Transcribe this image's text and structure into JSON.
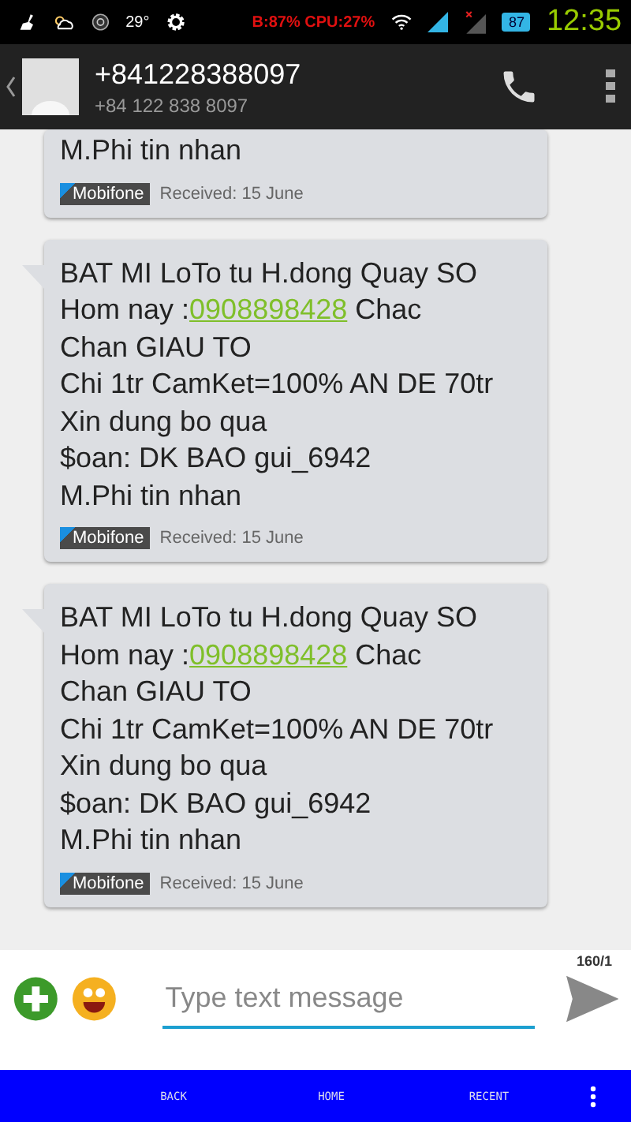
{
  "status_bar": {
    "temperature": "29°",
    "stats": "B:87% CPU:27%",
    "battery": "87",
    "time": "12:35"
  },
  "header": {
    "title": "+841228388097",
    "subtitle": "+84 122 838 8097"
  },
  "messages": [
    {
      "tail": false,
      "body": [
        {
          "kind": "text",
          "text": "M.Phi tin nhan"
        }
      ],
      "carrier": "Mobifone",
      "received": "Received: 15 June"
    },
    {
      "tail": true,
      "body": [
        {
          "kind": "text",
          "text": "BAT MI LoTo tu H.dong Quay SO\nHom nay :"
        },
        {
          "kind": "link",
          "text": "0908898428"
        },
        {
          "kind": "text",
          "text": " Chac\nChan GIAU TO\nChi 1tr CamKet=100% AN DE 70tr\nXin dung bo qua\n$oan: DK BAO gui_6942\nM.Phi tin nhan"
        }
      ],
      "carrier": "Mobifone",
      "received": "Received: 15 June"
    },
    {
      "tail": true,
      "body": [
        {
          "kind": "text",
          "text": "BAT MI LoTo tu H.dong Quay SO\nHom nay :"
        },
        {
          "kind": "link",
          "text": "0908898428"
        },
        {
          "kind": "text",
          "text": " Chac\nChan GIAU TO\nChi 1tr CamKet=100% AN DE 70tr\nXin dung bo qua\n$oan: DK BAO gui_6942\nM.Phi tin nhan"
        }
      ],
      "carrier": "Mobifone",
      "received": "Received: 15 June"
    }
  ],
  "compose": {
    "counter": "160/1",
    "placeholder": "Type text message"
  },
  "nav_bar": [
    "BACK",
    "HOME",
    "RECENT"
  ]
}
